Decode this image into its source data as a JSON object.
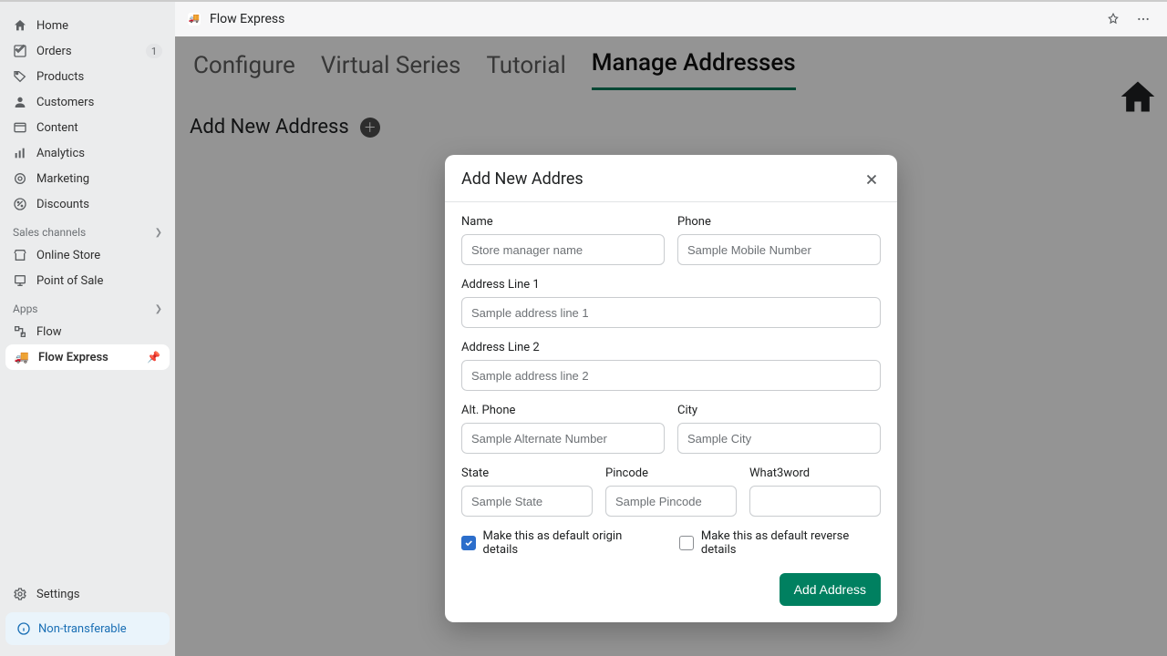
{
  "sidebar": {
    "nav": [
      {
        "label": "Home"
      },
      {
        "label": "Orders",
        "badge": "1"
      },
      {
        "label": "Products"
      },
      {
        "label": "Customers"
      },
      {
        "label": "Content"
      },
      {
        "label": "Analytics"
      },
      {
        "label": "Marketing"
      },
      {
        "label": "Discounts"
      }
    ],
    "sales_header": "Sales channels",
    "sales": [
      {
        "label": "Online Store"
      },
      {
        "label": "Point of Sale"
      }
    ],
    "apps_header": "Apps",
    "apps": [
      {
        "label": "Flow"
      },
      {
        "label": "Flow Express",
        "selected": true
      }
    ],
    "settings_label": "Settings",
    "non_transferable": "Non-transferable"
  },
  "topbar": {
    "app_title": "Flow Express"
  },
  "tabs": [
    "Configure",
    "Virtual Series",
    "Tutorial",
    "Manage Addresses"
  ],
  "active_tab": 3,
  "section_title": "Add New Address",
  "modal": {
    "title": "Add New Addres",
    "fields": {
      "name": {
        "label": "Name",
        "placeholder": "Store manager name"
      },
      "phone": {
        "label": "Phone",
        "placeholder": "Sample Mobile Number"
      },
      "addr1": {
        "label": "Address Line 1",
        "placeholder": "Sample address line 1"
      },
      "addr2": {
        "label": "Address Line 2",
        "placeholder": "Sample address line 2"
      },
      "altphone": {
        "label": "Alt. Phone",
        "placeholder": "Sample Alternate Number"
      },
      "city": {
        "label": "City",
        "placeholder": "Sample City"
      },
      "state": {
        "label": "State",
        "placeholder": "Sample State"
      },
      "pincode": {
        "label": "Pincode",
        "placeholder": "Sample Pincode"
      },
      "w3w": {
        "label": "What3word",
        "placeholder": ""
      }
    },
    "chk_origin": "Make this as default origin details",
    "chk_reverse": "Make this as default reverse details",
    "submit": "Add Address"
  }
}
